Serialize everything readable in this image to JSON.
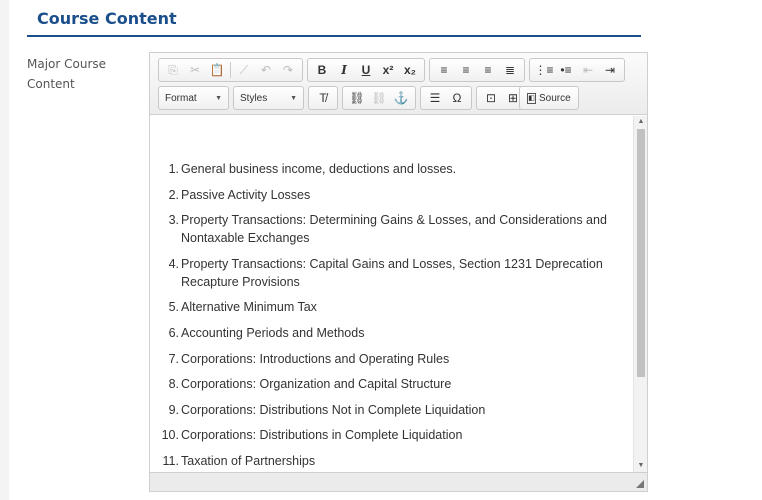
{
  "section": {
    "title": "Course Content",
    "field_label": "Major Course Content"
  },
  "toolbar": {
    "row1": [
      {
        "group": [
          {
            "name": "copy-icon",
            "glyph": "⎘",
            "disabled": true
          },
          {
            "name": "cut-icon",
            "glyph": "✂",
            "disabled": true
          },
          {
            "name": "paste-icon",
            "glyph": "📋",
            "disabled": false
          },
          {
            "sep": true
          },
          {
            "name": "remove-format-icon",
            "glyph": "⟋",
            "disabled": true
          },
          {
            "name": "undo-icon",
            "glyph": "↶",
            "disabled": true
          },
          {
            "name": "redo-icon",
            "glyph": "↷",
            "disabled": true
          }
        ]
      },
      {
        "group": [
          {
            "name": "bold-icon",
            "glyph": "B",
            "style": "bold"
          },
          {
            "name": "italic-icon",
            "glyph": "I",
            "style": "italic"
          },
          {
            "name": "underline-icon",
            "glyph": "U",
            "style": "underline"
          },
          {
            "name": "superscript-icon",
            "glyph": "x²",
            "style": "bold"
          },
          {
            "name": "subscript-icon",
            "glyph": "x₂",
            "style": "bold"
          }
        ]
      },
      {
        "group": [
          {
            "name": "align-left-icon",
            "glyph": "≡"
          },
          {
            "name": "align-center-icon",
            "glyph": "≡"
          },
          {
            "name": "align-right-icon",
            "glyph": "≡"
          },
          {
            "name": "align-justify-icon",
            "glyph": "≣"
          }
        ]
      },
      {
        "group": [
          {
            "name": "numbered-list-icon",
            "glyph": "⋮≡"
          },
          {
            "name": "bulleted-list-icon",
            "glyph": "•≡"
          },
          {
            "name": "outdent-icon",
            "glyph": "⇤",
            "disabled": true
          },
          {
            "name": "indent-icon",
            "glyph": "⇥"
          }
        ]
      }
    ],
    "format_label": "Format",
    "styles_label": "Styles",
    "row2": [
      {
        "group": [
          {
            "name": "clear-formatting-icon",
            "glyph": "T̸"
          }
        ]
      },
      {
        "group": [
          {
            "name": "link-icon",
            "glyph": "⛓"
          },
          {
            "name": "unlink-icon",
            "glyph": "⛓",
            "disabled": true
          },
          {
            "name": "anchor-icon",
            "glyph": "⚓"
          }
        ]
      },
      {
        "group": [
          {
            "name": "horizontal-line-icon",
            "glyph": "☰"
          },
          {
            "name": "special-char-icon",
            "glyph": "Ω"
          }
        ]
      },
      {
        "group": [
          {
            "name": "iframe-icon",
            "glyph": "⊡"
          },
          {
            "name": "table-icon",
            "glyph": "⊞"
          }
        ]
      }
    ],
    "source_label": "Source"
  },
  "content": {
    "items": [
      {
        "num": "1",
        "text": "General business income, deductions and losses."
      },
      {
        "num": "2",
        "text": "Passive Activity Losses"
      },
      {
        "num": "3",
        "text": "Property Transactions: Determining Gains & Losses, and Considerations and Nontaxable Exchanges"
      },
      {
        "num": "4",
        "text": "Property Transactions: Capital Gains and Losses, Section 1231 Deprecation Recapture Provisions"
      },
      {
        "num": "5",
        "text": "Alternative Minimum Tax"
      },
      {
        "num": "6",
        "text": "Accounting Periods and Methods"
      },
      {
        "num": "7",
        "text": "Corporations: Introductions and Operating Rules"
      },
      {
        "num": "8",
        "text": "Corporations: Organization and Capital Structure"
      },
      {
        "num": "9",
        "text": "Corporations: Distributions Not in Complete Liquidation"
      },
      {
        "num": "10",
        "text": "Corporations: Distributions in Complete Liquidation"
      },
      {
        "num": "11",
        "text": "Taxation of Partnerships"
      }
    ]
  },
  "colors": {
    "accent": "#1a4f8b"
  }
}
